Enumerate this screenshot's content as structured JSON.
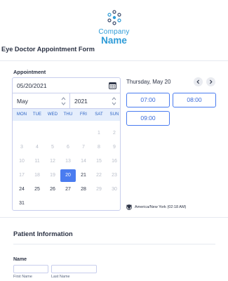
{
  "logo": {
    "company": "Company",
    "name": "Name",
    "brand_color": "#2d9bd7",
    "icon": "molecule-logo-icon"
  },
  "form": {
    "title": "Eye Doctor Appointment Form"
  },
  "appointment": {
    "label": "Appointment",
    "date_value": "05/20/2021",
    "month": "May",
    "year": "2021",
    "weekdays": [
      "MON",
      "TUE",
      "WED",
      "THU",
      "FRI",
      "SAT",
      "SUN"
    ],
    "weeks": [
      [
        {
          "d": ""
        },
        {
          "d": ""
        },
        {
          "d": ""
        },
        {
          "d": ""
        },
        {
          "d": ""
        },
        {
          "d": "1",
          "muted": true
        },
        {
          "d": "2",
          "muted": true
        }
      ],
      [
        {
          "d": "3",
          "muted": true
        },
        {
          "d": "4",
          "muted": true
        },
        {
          "d": "5",
          "muted": true
        },
        {
          "d": "6",
          "muted": true
        },
        {
          "d": "7",
          "muted": true
        },
        {
          "d": "8",
          "muted": true
        },
        {
          "d": "9",
          "muted": true
        }
      ],
      [
        {
          "d": "10",
          "muted": true
        },
        {
          "d": "11",
          "muted": true
        },
        {
          "d": "12",
          "muted": true
        },
        {
          "d": "13",
          "muted": true
        },
        {
          "d": "14",
          "muted": true
        },
        {
          "d": "15",
          "muted": true
        },
        {
          "d": "16",
          "muted": true
        }
      ],
      [
        {
          "d": "17",
          "muted": true
        },
        {
          "d": "18",
          "muted": true
        },
        {
          "d": "19",
          "muted": true
        },
        {
          "d": "20",
          "selected": true
        },
        {
          "d": "21"
        },
        {
          "d": "22",
          "muted": true
        },
        {
          "d": "23",
          "muted": true
        }
      ],
      [
        {
          "d": "24"
        },
        {
          "d": "25"
        },
        {
          "d": "26"
        },
        {
          "d": "27"
        },
        {
          "d": "28"
        },
        {
          "d": "29",
          "muted": true
        },
        {
          "d": "30",
          "muted": true
        }
      ],
      [
        {
          "d": "31"
        },
        {
          "d": ""
        },
        {
          "d": ""
        },
        {
          "d": ""
        },
        {
          "d": ""
        },
        {
          "d": ""
        },
        {
          "d": ""
        }
      ]
    ],
    "selected_date_heading": "Thursday, May 20",
    "slots": [
      "07:00",
      "08:00",
      "09:00"
    ],
    "timezone": "America/New York (02:18 AM)",
    "accent_color": "#4a7cf0"
  },
  "patient": {
    "section_title": "Patient Information",
    "name_label": "Name",
    "first_name_value": "",
    "last_name_value": "",
    "first_name_sublabel": "First Name",
    "last_name_sublabel": "Last Name"
  }
}
